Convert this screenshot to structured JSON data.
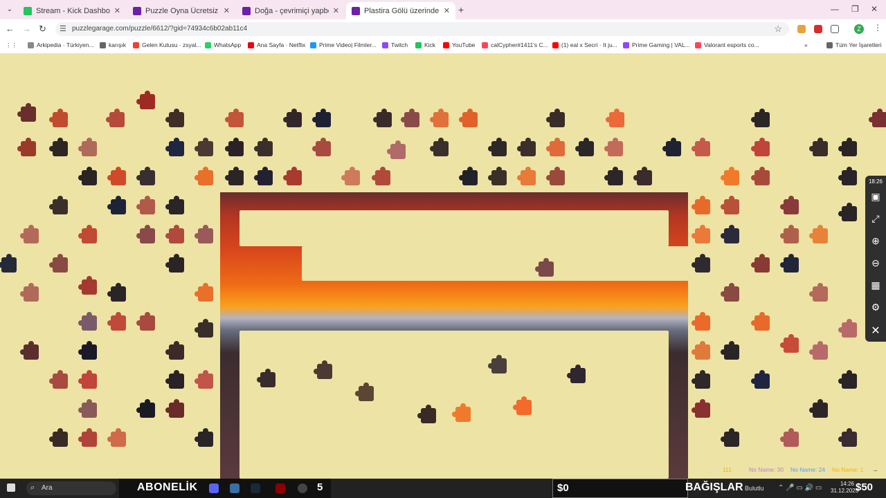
{
  "browser": {
    "tabs": [
      {
        "title": "Stream - Kick Dashboard",
        "favicon_color": "#22c55e"
      },
      {
        "title": "Puzzle Oyna Ücretsiz – Yetişkin",
        "favicon_color": "#6b21a8"
      },
      {
        "title": "Doğa - çevrimiçi yapboz koleks",
        "favicon_color": "#6b21a8"
      },
      {
        "title": "Plastira Gölü üzerinde gün batı",
        "favicon_color": "#6b21a8"
      }
    ],
    "new_tab_label": "+",
    "url": "puzzlegarage.com/puzzle/6612/?gid=74934c6b02ab11c4",
    "bookmarks": [
      {
        "label": "Arkipedia · Türkiyen...",
        "color": "#888888"
      },
      {
        "label": "karışık",
        "color": "#666666"
      },
      {
        "label": "Gelen Kutusu · zsyal...",
        "color": "#ea4335"
      },
      {
        "label": "WhatsApp",
        "color": "#25d366"
      },
      {
        "label": "Ana Sayfa · Netflix",
        "color": "#e50914"
      },
      {
        "label": "Prime Video| Filmler...",
        "color": "#1a98ff"
      },
      {
        "label": "Twitch",
        "color": "#9146ff"
      },
      {
        "label": "Kick",
        "color": "#22c55e"
      },
      {
        "label": "YouTube",
        "color": "#ff0000"
      },
      {
        "label": "calCypher#1411's C...",
        "color": "#ff4655"
      },
      {
        "label": "(1) eal x Secri · It ju...",
        "color": "#ff0000"
      },
      {
        "label": "Prime Gaming | VAL...",
        "color": "#9146ff"
      },
      {
        "label": "Valorant esports co...",
        "color": "#ff4655"
      }
    ],
    "bookmarks_overflow": "»",
    "all_bookmarks": "Tüm Yer İşaretleri"
  },
  "game": {
    "clock": "18:26",
    "stats": [
      {
        "label": "",
        "value": "111",
        "color": "#f7b500"
      },
      {
        "label": "No Name:",
        "value": "30",
        "color": "#c07fd8"
      },
      {
        "label": "No Name:",
        "value": "24",
        "color": "#4aa3ff"
      },
      {
        "label": "No Name:",
        "value": "1",
        "color": "#f7b500"
      }
    ]
  },
  "taskbar": {
    "search_placeholder": "Ara",
    "abonelik": "ABONELİK",
    "count": "5",
    "dollar_left": "$0",
    "bagislar": "BAĞIŞLAR",
    "weather": "Bulutlu",
    "time": "14:26",
    "date": "31.12.2025",
    "dollar_right": "$50"
  }
}
